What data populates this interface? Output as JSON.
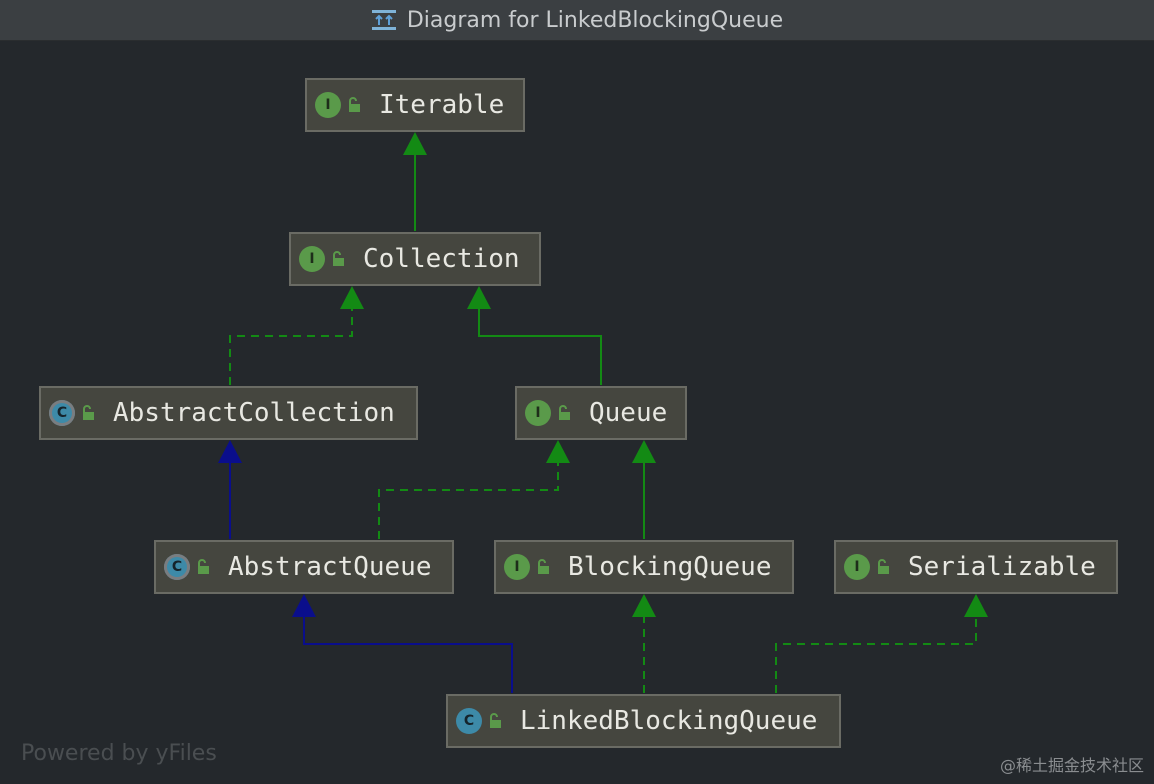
{
  "window": {
    "title": "Diagram for LinkedBlockingQueue",
    "title_icon": "diagram-icon"
  },
  "colors": {
    "background": "#24282c",
    "node_fill": "#45463f",
    "implements_edge": "#138a14",
    "extends_edge": "#0a0e8c"
  },
  "nodes": {
    "iterable": {
      "label": "Iterable",
      "kind": "interface",
      "badge": "I"
    },
    "collection": {
      "label": "Collection",
      "kind": "interface",
      "badge": "I"
    },
    "abstract_collection": {
      "label": "AbstractCollection",
      "kind": "abstract-class",
      "badge": "C"
    },
    "queue": {
      "label": "Queue",
      "kind": "interface",
      "badge": "I"
    },
    "abstract_queue": {
      "label": "AbstractQueue",
      "kind": "abstract-class",
      "badge": "C"
    },
    "blocking_queue": {
      "label": "BlockingQueue",
      "kind": "interface",
      "badge": "I"
    },
    "serializable": {
      "label": "Serializable",
      "kind": "interface",
      "badge": "I"
    },
    "linked_blocking_queue": {
      "label": "LinkedBlockingQueue",
      "kind": "class",
      "badge": "C"
    }
  },
  "edges": [
    {
      "from": "Collection",
      "to": "Iterable",
      "style": "solid",
      "color": "green"
    },
    {
      "from": "AbstractCollection",
      "to": "Collection",
      "style": "dashed",
      "color": "green"
    },
    {
      "from": "Queue",
      "to": "Collection",
      "style": "solid",
      "color": "green"
    },
    {
      "from": "AbstractQueue",
      "to": "AbstractCollection",
      "style": "solid",
      "color": "blue"
    },
    {
      "from": "AbstractQueue",
      "to": "Queue",
      "style": "dashed",
      "color": "green"
    },
    {
      "from": "BlockingQueue",
      "to": "Queue",
      "style": "solid",
      "color": "green"
    },
    {
      "from": "LinkedBlockingQueue",
      "to": "AbstractQueue",
      "style": "solid",
      "color": "blue"
    },
    {
      "from": "LinkedBlockingQueue",
      "to": "BlockingQueue",
      "style": "dashed",
      "color": "green"
    },
    {
      "from": "LinkedBlockingQueue",
      "to": "Serializable",
      "style": "dashed",
      "color": "green"
    }
  ],
  "footer": {
    "powered_by": "Powered by yFiles",
    "watermark": "@稀土掘金技术社区"
  }
}
